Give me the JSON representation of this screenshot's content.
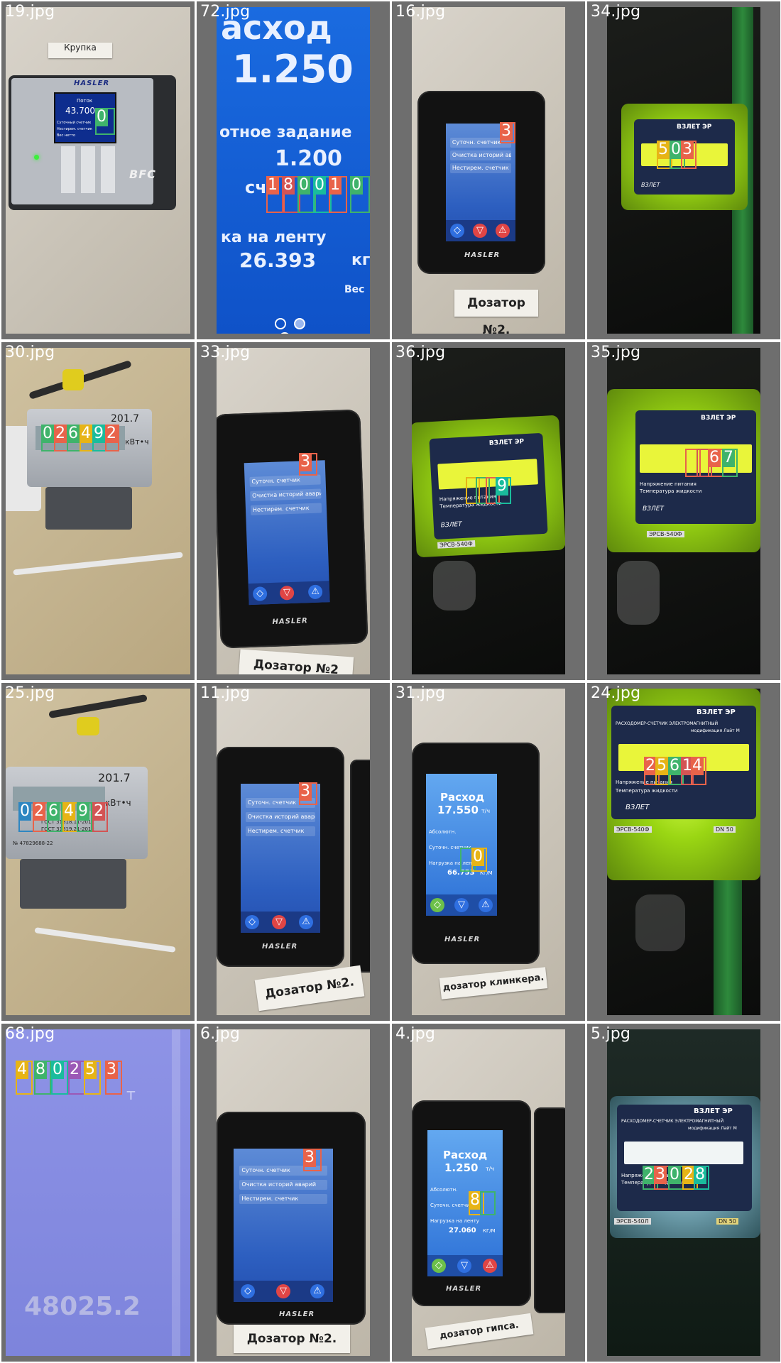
{
  "cells": [
    {
      "label": "19.jpg",
      "texts": {
        "sign": "Крупка",
        "brand": "HASLER",
        "brand2": "BFC",
        "l1": "Поток",
        "l2": "43.700",
        "l3": "Суточный счетчик",
        "l4": "Нестирем. счетчик",
        "l5": "Вес нетто"
      },
      "detections": [
        "0"
      ]
    },
    {
      "label": "72.jpg",
      "texts": {
        "l1": "асход",
        "l2": "1.250",
        "l3": "отное задание",
        "l4": "1.200",
        "l5": "сч",
        "l6": "ка на ленту",
        "l7": "26.393",
        "l8": "кг",
        "l9": "Вес"
      },
      "detections": [
        "1",
        "8",
        "0",
        "0",
        "1",
        "0"
      ]
    },
    {
      "label": "16.jpg",
      "texts": {
        "brand": "HASLER",
        "sign": "Дозатор №2.",
        "r1": "Суточн. счетчик",
        "r2": "Очистка историй аварий",
        "r3": "Нестирем. счетчик"
      },
      "detections": [
        "3"
      ]
    },
    {
      "label": "34.jpg",
      "texts": {
        "brand": "ВЗЛЕТ ЭР",
        "logo": "ВЗЛЕТ"
      },
      "detections": [
        "5",
        "0",
        "3"
      ]
    },
    {
      "label": "30.jpg",
      "texts": {
        "model": "201.7",
        "unit": "кВт•ч"
      },
      "detections": [
        "0",
        "2",
        "6",
        "4",
        "9",
        "2"
      ]
    },
    {
      "label": "33.jpg",
      "texts": {
        "brand": "HASLER",
        "sign": "Дозатор №2",
        "r1": "Суточн. счетчик",
        "r2": "Очистка историй аварий",
        "r3": "Нестирем. счетчик"
      },
      "detections": [
        "3"
      ]
    },
    {
      "label": "36.jpg",
      "texts": {
        "brand": "ВЗЛЕТ ЭР",
        "logo": "ВЗЛЕТ",
        "l1": "Напряжение питания",
        "l2": "Температура жидкости",
        "tag": "ЭРСВ-540Ф"
      },
      "detections": [
        "9"
      ]
    },
    {
      "label": "35.jpg",
      "texts": {
        "brand": "ВЗЛЕТ ЭР",
        "logo": "ВЗЛЕТ",
        "l1": "Напряжение питания",
        "l2": "Температура жидкости",
        "tag": "ЭРСВ-540Ф"
      },
      "detections": [
        "6",
        "7"
      ]
    },
    {
      "label": "25.jpg",
      "texts": {
        "model": "201.7",
        "unit": "кВт•ч",
        "g1": "ГОСТ 31818.11-2012",
        "g2": "ГОСТ 31819.21-2012",
        "num": "№ 47829688-22"
      },
      "detections": [
        "0",
        "2",
        "6",
        "4",
        "9",
        "2"
      ]
    },
    {
      "label": "11.jpg",
      "texts": {
        "brand": "HASLER",
        "sign": "Дозатор №2.",
        "r1": "Суточн. счетчик",
        "r2": "Очистка историй аварий",
        "r3": "Нестирем. счетчик"
      },
      "detections": [
        "3"
      ]
    },
    {
      "label": "31.jpg",
      "texts": {
        "brand": "HASLER",
        "sign": "дозатор клинкера.",
        "l1": "Расход",
        "l2": "17.550",
        "l2u": "т/ч",
        "l3": "Абсолютн.",
        "l4": "Суточн. счетчик",
        "l5": "Нагрузка на ленту",
        "l6": "66.753",
        "l6u": "КГ/М"
      },
      "detections": [
        "0"
      ]
    },
    {
      "label": "24.jpg",
      "texts": {
        "brand": "ВЗЛЕТ ЭР",
        "sub1": "РАСХОДОМЕР-СЧЕТЧИК ЭЛЕКТРОМАГНИТНЫЙ",
        "sub2": "модификация Лайт М",
        "l1": "Напряжение питания",
        "l2": "Температура жидкости",
        "logo": "ВЗЛЕТ",
        "tag": "ЭРСВ-540Ф",
        "dn": "DN 50"
      },
      "detections": [
        "2",
        "5",
        "6",
        "1",
        "4"
      ]
    },
    {
      "label": "68.jpg",
      "texts": {
        "bottom": "48025.2",
        "unit": "т"
      },
      "detections": [
        "4",
        "8",
        "0",
        "2",
        "5",
        "3"
      ]
    },
    {
      "label": "6.jpg",
      "texts": {
        "brand": "HASLER",
        "sign": "Дозатор №2.",
        "r1": "Суточн. счетчик",
        "r2": "Очистка историй аварий",
        "r3": "Нестирем. счетчик"
      },
      "detections": [
        "3"
      ]
    },
    {
      "label": "4.jpg",
      "texts": {
        "brand": "HASLER",
        "sign": "дозатор гипса.",
        "l1": "Расход",
        "l2": "1.250",
        "l2u": "т/ч",
        "l3": "Абсолютн.",
        "l4": "Суточн. счетчик",
        "l5": "Нагрузка на ленту",
        "l6": "27.060",
        "l6u": "КГ/М"
      },
      "detections": [
        "8"
      ]
    },
    {
      "label": "5.jpg",
      "texts": {
        "brand": "ВЗЛЕТ ЭР",
        "sub1": "РАСХОДОМЕР-СЧЕТЧИК ЭЛЕКТРОМАГНИТНЫЙ",
        "sub2": "модификация Лайт М",
        "l1": "Напряжение питания",
        "l2": "Температура жидкости",
        "tag": "ЭРСВ-540Л",
        "dn": "DN 50"
      },
      "detections": [
        "2",
        "3",
        "0",
        "2",
        "8"
      ]
    }
  ],
  "colors": {
    "det": [
      "#e8634a",
      "#3fb36b",
      "#2e86c1",
      "#e7b416",
      "#9b59b6",
      "#d35454",
      "#1abc9c",
      "#f39c12"
    ]
  }
}
